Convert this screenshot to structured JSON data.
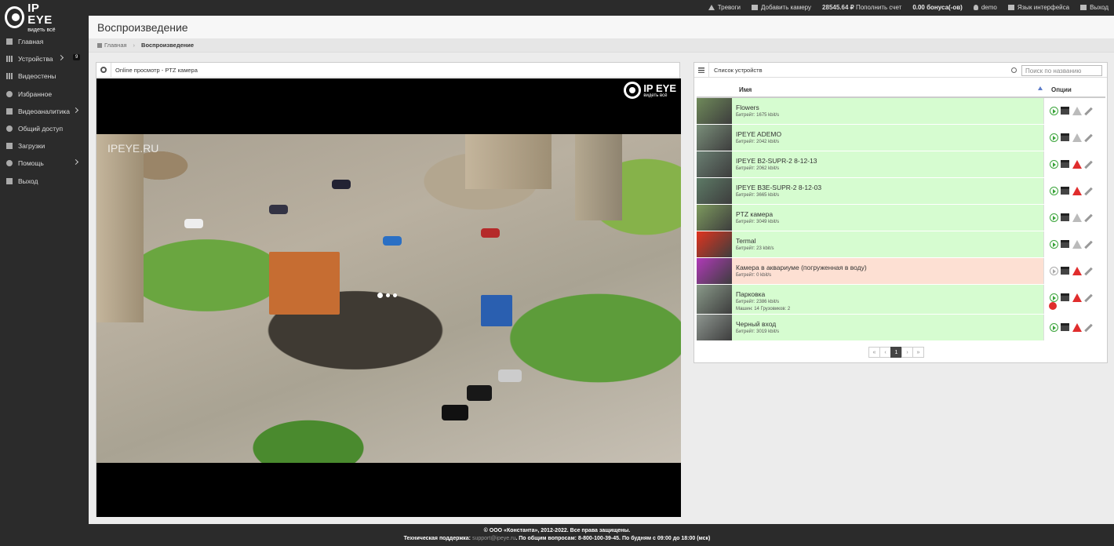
{
  "brand": {
    "name": "IP EYE",
    "slogan": "видеть всё"
  },
  "topnav": {
    "alarms": "Тревоги",
    "add_camera": "Добавить камеру",
    "balance": "28545.64 ₽",
    "top_up": "Пополнить счет",
    "bonus": "0.00 бонуса(-ов)",
    "user": "demo",
    "language": "Язык интерфейса",
    "logout": "Выход"
  },
  "sidebar": {
    "items": [
      {
        "label": "Главная",
        "icon": "home-icon"
      },
      {
        "label": "Устройства",
        "icon": "devices-icon",
        "badge": "9"
      },
      {
        "label": "Видеостены",
        "icon": "grid-icon"
      },
      {
        "label": "Избранное",
        "icon": "star-icon"
      },
      {
        "label": "Видеоаналитика",
        "icon": "analytics-icon"
      },
      {
        "label": "Общий доступ",
        "icon": "share-icon"
      },
      {
        "label": "Загрузки",
        "icon": "download-icon"
      },
      {
        "label": "Помощь",
        "icon": "info-icon"
      },
      {
        "label": "Выход",
        "icon": "logout-icon"
      }
    ]
  },
  "page": {
    "title": "Воспроизведение",
    "breadcrumb": {
      "home": "Главная",
      "current": "Воспроизведение"
    }
  },
  "player": {
    "header": "Online просмотр - PTZ камера",
    "watermark": "IPEYE.RU"
  },
  "devices": {
    "header": "Список устройств",
    "search_placeholder": "Поиск по названию",
    "col_name": "Имя",
    "col_options": "Опции",
    "rows": [
      {
        "name": "Flowers",
        "bitrate": "Битрейт: 1675 kbit/s",
        "status": "online",
        "alarm": false,
        "thumb": "#6f8a5a"
      },
      {
        "name": "IPEYE ADEMO",
        "bitrate": "Битрейт: 2042 kbit/s",
        "status": "online",
        "alarm": false,
        "thumb": "#7a8f7a"
      },
      {
        "name": "IPEYE B2-SUPR-2 8-12-13",
        "bitrate": "Битрейт: 2062 kbit/s",
        "status": "online",
        "alarm": true,
        "thumb": "#6a7f72"
      },
      {
        "name": "IPEYE B3E-SUPR-2 8-12-03",
        "bitrate": "Битрейт: 3665 kbit/s",
        "status": "online",
        "alarm": true,
        "thumb": "#5d7a66"
      },
      {
        "name": "PTZ камера",
        "bitrate": "Битрейт: 3049 kbit/s",
        "status": "online",
        "alarm": false,
        "thumb": "#7d9a5e"
      },
      {
        "name": "Termal",
        "bitrate": "Битрейт: 23 kbit/s",
        "status": "online",
        "alarm": false,
        "thumb": "#e0341f"
      },
      {
        "name": "Камера в аквариуме (погруженная в воду)",
        "bitrate": "Битрейт: 0 kbit/s",
        "status": "offline",
        "alarm": true,
        "thumb": "#b03ab8"
      },
      {
        "name": "Парковка",
        "bitrate": "Битрейт: 2386 kbit/s",
        "extra": "Машин: 14    Грузовиков: 2",
        "status": "online",
        "alarm": true,
        "analytics": true,
        "thumb": "#8a9a8a"
      },
      {
        "name": "Черный вход",
        "bitrate": "Битрейт: 3019 kbit/s",
        "status": "online",
        "alarm": true,
        "thumb": "#8e9690"
      }
    ],
    "pager": {
      "first": "«",
      "prev": "‹",
      "current": "1",
      "next": "›",
      "last": "»"
    }
  },
  "footer": {
    "copyright": "© ООО «Константа», 2012-2022. Все права защищены.",
    "support_label": "Техническая поддержка:",
    "support_email": "support@ipeye.ru",
    "general": ". По общим вопросам: 8-800-100-39-45. По будням с 09:00 до 18:00 (мск)"
  },
  "colors": {
    "sidebar_bg": "#2b2b2b",
    "row_online": "#d6fcd0",
    "row_offline": "#fde0d3",
    "play": "#3aa43a",
    "alarm": "#e02d2d"
  }
}
